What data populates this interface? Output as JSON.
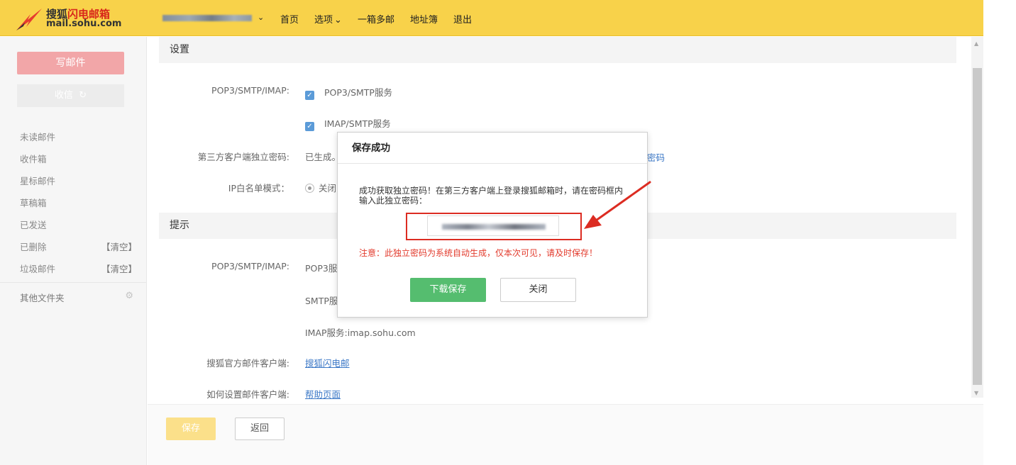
{
  "brand": {
    "name_black": "搜狐",
    "name_red": "闪电邮箱",
    "url": "mail.sohu.com"
  },
  "topnav": {
    "items": [
      "首页",
      "选项",
      "一箱多邮",
      "地址簿",
      "退出"
    ],
    "dropdown_indicator": "⌄"
  },
  "sidebar": {
    "compose": "写邮件",
    "receive": "收信",
    "receive_icon": "refresh-icon",
    "folders": [
      {
        "name": "未读邮件",
        "action": ""
      },
      {
        "name": "收件箱",
        "action": ""
      },
      {
        "name": "星标邮件",
        "action": ""
      },
      {
        "name": "草稿箱",
        "action": ""
      },
      {
        "name": "已发送",
        "action": ""
      },
      {
        "name": "已删除",
        "action": "【清空】"
      },
      {
        "name": "垃圾邮件",
        "action": "【清空】"
      }
    ],
    "other_folders": "其他文件夹",
    "other_icon": "gear-icon"
  },
  "settings": {
    "title": "设置",
    "pop3_label": "POP3/SMTP/IMAP:",
    "pop3_option": "POP3/SMTP服务",
    "imap_option": "IMAP/SMTP服务",
    "client_pwd_label": "第三方客户端独立密码:",
    "client_pwd_value": "已生成。",
    "client_pwd_link_fragment": "密码",
    "ip_label": "IP白名单模式：",
    "ip_value": "关闭"
  },
  "tips": {
    "title": "提示",
    "server_label": "POP3/SMTP/IMAP:",
    "pop3_server": "POP3服",
    "smtp_server": "SMTP服",
    "imap_server": "IMAP服务:imap.sohu.com",
    "official_client_label": "搜狐官方邮件客户端:",
    "official_client_link": "搜狐闪电邮",
    "howto_label": "如何设置邮件客户端:",
    "howto_link": "帮助页面"
  },
  "footer": {
    "save": "保存",
    "back": "返回"
  },
  "dialog": {
    "title": "保存成功",
    "message": "成功获取独立密码！在第三方客户端上登录搜狐邮箱时，请在密码框内输入此独立密码：",
    "warning": "注意：此独立密码为系统自动生成，仅本次可见，请及时保存！",
    "download": "下载保存",
    "close": "关闭"
  },
  "colors": {
    "topbar": "#f8d24a",
    "compose": "#f2a6a8",
    "download": "#55bd6f",
    "warning": "#e23a2c",
    "highlight": "#dc2c22"
  }
}
